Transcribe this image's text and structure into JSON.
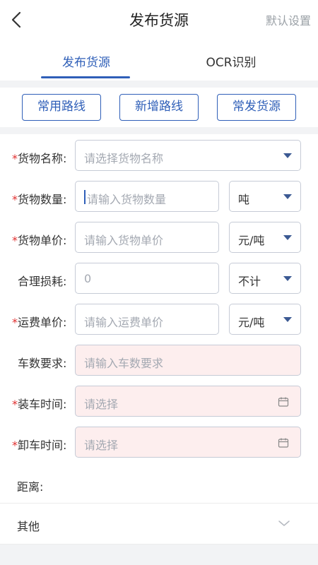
{
  "header": {
    "title": "发布货源",
    "right_action": "默认设置"
  },
  "tabs": [
    {
      "label": "发布货源",
      "active": true
    },
    {
      "label": "OCR识别",
      "active": false
    }
  ],
  "quick_actions": [
    "常用路线",
    "新增路线",
    "常发货源"
  ],
  "form": {
    "cargo_name": {
      "label": "货物名称:",
      "required": true,
      "placeholder": "请选择货物名称"
    },
    "cargo_qty": {
      "label": "货物数量:",
      "required": true,
      "placeholder": "请输入货物数量",
      "unit": "吨"
    },
    "cargo_price": {
      "label": "货物单价:",
      "required": true,
      "placeholder": "请输入货物单价",
      "unit": "元/吨"
    },
    "loss": {
      "label": "合理损耗:",
      "required": false,
      "value": "0",
      "unit": "不计"
    },
    "freight_price": {
      "label": "运费单价:",
      "required": true,
      "placeholder": "请输入运费单价",
      "unit": "元/吨"
    },
    "truck_req": {
      "label": "车数要求:",
      "required": false,
      "placeholder": "请输入车数要求"
    },
    "load_time": {
      "label": "装车时间:",
      "required": true,
      "placeholder": "请选择"
    },
    "unload_time": {
      "label": "卸车时间:",
      "required": true,
      "placeholder": "请选择"
    },
    "distance": {
      "label": "距离:"
    },
    "other": {
      "label": "其他"
    }
  },
  "required_mark": "*",
  "colors": {
    "accent": "#2f5fb8",
    "required": "#e03030",
    "pink_field": "#fdeeee",
    "band": "#f2f3f5"
  }
}
